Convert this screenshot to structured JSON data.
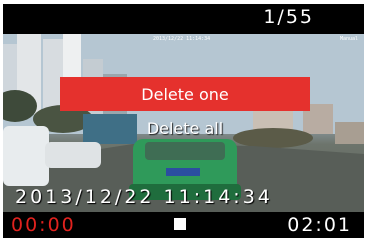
{
  "header": {
    "file_counter": "1/55"
  },
  "preview": {
    "timestamp": "2013/12/22  11:14:34",
    "top_stamp_left": "2013/12/22 11:14:34",
    "top_stamp_right": "Manual"
  },
  "menu": {
    "items": [
      {
        "label": "Delete one",
        "selected": true
      },
      {
        "label": "Delete all",
        "selected": false
      }
    ],
    "selected_color": "#e5312d"
  },
  "footer": {
    "rec_time": "00:00",
    "rec_color": "#e0221e",
    "status_icon": "stop-icon",
    "duration": "02:01"
  }
}
